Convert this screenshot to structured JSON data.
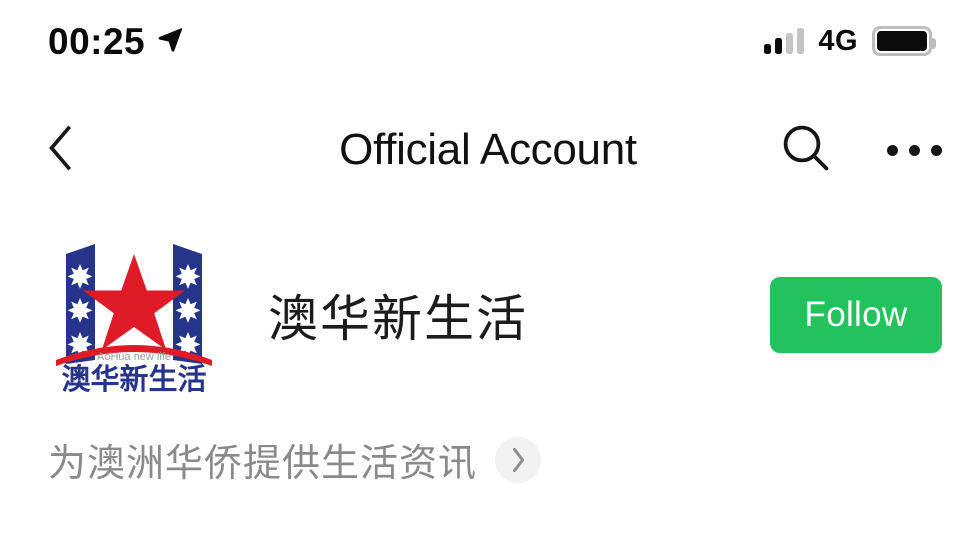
{
  "status_bar": {
    "time": "00:25",
    "location_icon": "location-arrow-icon",
    "signal_icon": "signal-bars-icon",
    "network_type": "4G",
    "battery_icon": "battery-full-icon"
  },
  "nav_bar": {
    "back_icon": "chevron-left-icon",
    "title": "Official Account",
    "search_icon": "search-icon",
    "more_icon": "more-horizontal-icon"
  },
  "account": {
    "avatar_name": "aohua-newlife-logo",
    "avatar_logo": {
      "latin_tagline": "AoHua new life",
      "chinese_wordmark": "澳华新生活",
      "star_count_per_banner": 3,
      "colors": {
        "banner_blue": "#27348B",
        "star_red": "#DE1B26",
        "wordmark_blue": "#27348B",
        "tagline_gray": "#9b9b9b"
      }
    },
    "name": "澳华新生活",
    "follow_label": "Follow",
    "follow_color": "#22C25C",
    "description": "为澳洲华侨提供生活资讯",
    "description_chevron_icon": "chevron-right-icon"
  }
}
